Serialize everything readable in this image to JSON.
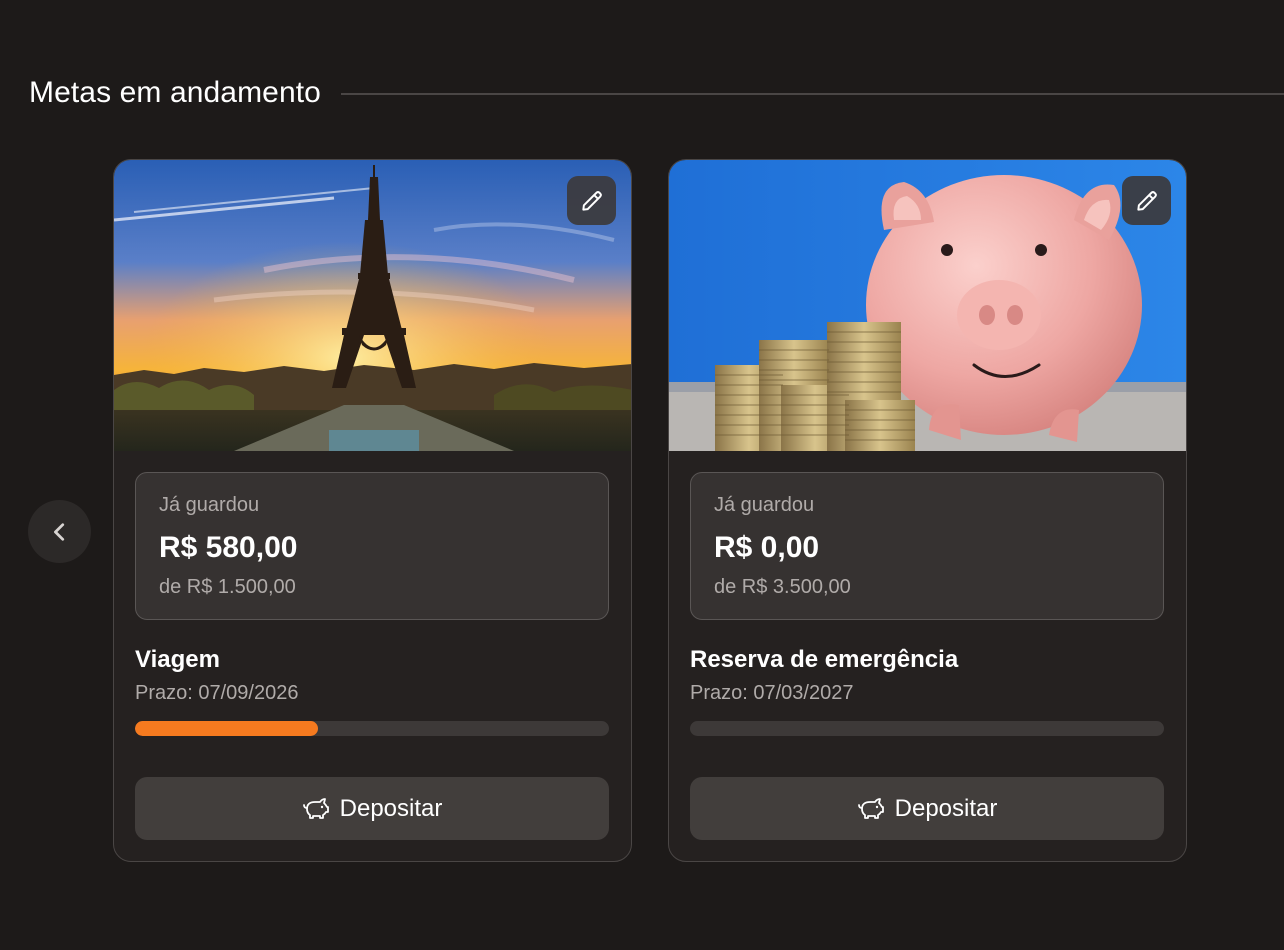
{
  "section": {
    "title": "Metas em andamento"
  },
  "carousel": {
    "prev_icon": "chevron-left-icon"
  },
  "goals": [
    {
      "image": "eiffel-tower-sunset",
      "edit_icon": "pencil-icon",
      "saved_label": "Já guardou",
      "saved_amount": "R$ 580,00",
      "target_text": "de R$ 1.500,00",
      "name": "Viagem",
      "deadline_label": "Prazo:",
      "deadline_value": "07/09/2026",
      "progress": 0.387,
      "deposit_label": "Depositar",
      "deposit_icon": "piggy-bank-icon"
    },
    {
      "image": "piggy-bank-coins",
      "edit_icon": "pencil-icon",
      "saved_label": "Já guardou",
      "saved_amount": "R$ 0,00",
      "target_text": "de R$ 3.500,00",
      "name": "Reserva de emergência",
      "deadline_label": "Prazo:",
      "deadline_value": "07/03/2027",
      "progress": 0,
      "deposit_label": "Depositar",
      "deposit_icon": "piggy-bank-icon"
    }
  ],
  "colors": {
    "background": "#1d1a19",
    "card": "#252120",
    "accent": "#f57a1f",
    "muted_text": "#b0aba9"
  }
}
